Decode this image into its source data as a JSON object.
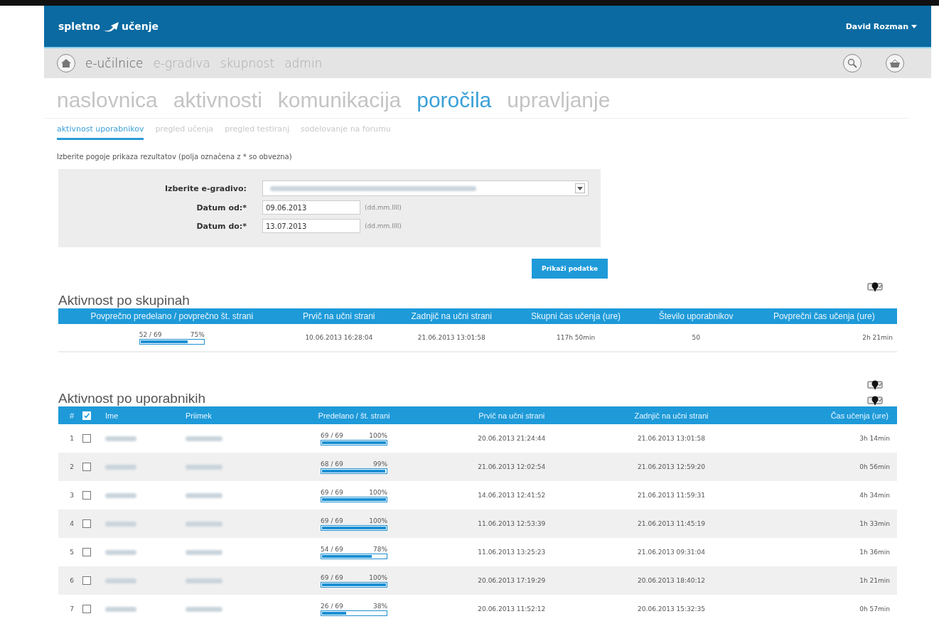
{
  "header": {
    "logo_left": "spletno",
    "logo_right": "učenje",
    "user": "David Rozman"
  },
  "main_nav": [
    {
      "label": "e-učilnice",
      "selected": true
    },
    {
      "label": "e-gradiva",
      "selected": false
    },
    {
      "label": "skupnost",
      "selected": false
    },
    {
      "label": "admin",
      "selected": false
    }
  ],
  "section_nav": [
    {
      "label": "naslovnica",
      "selected": false
    },
    {
      "label": "aktivnosti",
      "selected": false
    },
    {
      "label": "komunikacija",
      "selected": false
    },
    {
      "label": "poročila",
      "selected": true
    },
    {
      "label": "upravljanje",
      "selected": false
    }
  ],
  "sub_tabs": [
    {
      "label": "aktivnost uporabnikov",
      "selected": true
    },
    {
      "label": "pregled učenja",
      "selected": false
    },
    {
      "label": "pregled testiranj",
      "selected": false
    },
    {
      "label": "sodelovanje na forumu",
      "selected": false
    }
  ],
  "hint": "Izberite pogoje prikaza rezultatov (polja označena z * so obvezna)",
  "form": {
    "material_label": "Izberite e-gradivo:",
    "date_from_label": "Datum od:*",
    "date_from": "09.06.2013",
    "date_to_label": "Datum do:*",
    "date_to": "13.07.2013",
    "format_hint_from": "(dd.mm.llll)",
    "format_hint_to": "(dd.mm.llll)",
    "submit": "Prikaži podatke"
  },
  "group_table": {
    "title": "Aktivnost po skupinah",
    "columns": [
      "Povprečno predelano / povprečno št. strani",
      "Prvič na učni strani",
      "Zadnjič na učni strani",
      "Skupni čas učenja (ure)",
      "Število uporabnikov",
      "Povprečni čas učenja (ure)"
    ],
    "rows": [
      {
        "pages": "52 / 69",
        "percent": "75%",
        "level": 0.75,
        "first": "10.06.2013 16:28:04",
        "last": "21.06.2013 13:01:58",
        "total": "117h 50min",
        "users": "50",
        "avg": "2h 21min"
      }
    ]
  },
  "user_table": {
    "title": "Aktivnost po uporabnikih",
    "columns": [
      "#",
      "Ime",
      "Priimek",
      "Predelano / št. strani",
      "Prvič na učni strani",
      "Zadnjič na učni strani",
      "Čas učenja (ure)"
    ],
    "select_all_checked": true,
    "rows": [
      {
        "num": "1",
        "checked": false,
        "pages": "69 / 69",
        "percent": "100%",
        "level": 1,
        "first": "20.06.2013 21:24:44",
        "last": "21.06.2013 13:01:58",
        "time": "3h 14min"
      },
      {
        "num": "2",
        "checked": false,
        "pages": "68 / 69",
        "percent": "99%",
        "level": 0.99,
        "first": "21.06.2013 12:02:54",
        "last": "21.06.2013 12:59:20",
        "time": "0h 56min"
      },
      {
        "num": "3",
        "checked": false,
        "pages": "69 / 69",
        "percent": "100%",
        "level": 1,
        "first": "14.06.2013 12:41:52",
        "last": "21.06.2013 11:59:31",
        "time": "4h 34min"
      },
      {
        "num": "4",
        "checked": false,
        "pages": "69 / 69",
        "percent": "100%",
        "level": 1,
        "first": "11.06.2013 12:53:39",
        "last": "21.06.2013 11:45:19",
        "time": "1h 33min"
      },
      {
        "num": "5",
        "checked": false,
        "pages": "54 / 69",
        "percent": "78%",
        "level": 0.78,
        "first": "11.06.2013 13:25:23",
        "last": "21.06.2013 09:31:04",
        "time": "1h 36min"
      },
      {
        "num": "6",
        "checked": false,
        "pages": "69 / 69",
        "percent": "100%",
        "level": 1,
        "first": "20.06.2013 17:19:29",
        "last": "20.06.2013 18:40:12",
        "time": "1h 21min"
      },
      {
        "num": "7",
        "checked": false,
        "pages": "26 / 69",
        "percent": "38%",
        "level": 0.38,
        "first": "20.06.2013 11:52:12",
        "last": "20.06.2013 15:32:35",
        "time": "0h 57min"
      }
    ]
  }
}
